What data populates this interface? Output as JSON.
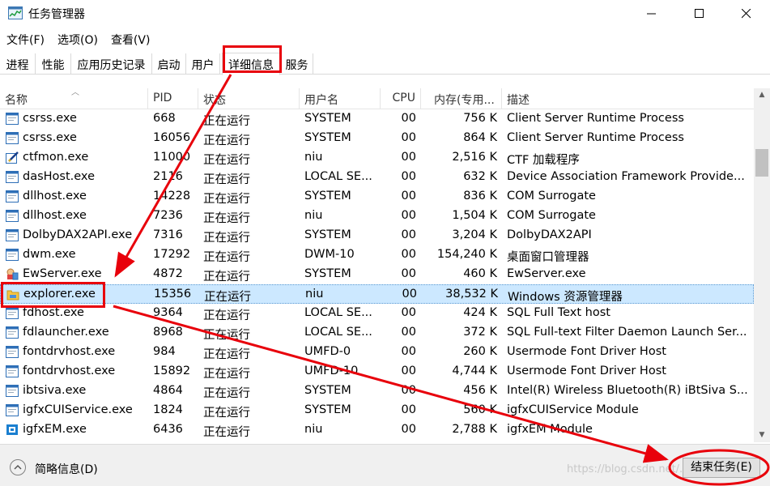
{
  "window": {
    "title": "任务管理器"
  },
  "menu": [
    "文件(F)",
    "选项(O)",
    "查看(V)"
  ],
  "tabs": [
    "进程",
    "性能",
    "应用历史记录",
    "启动",
    "用户",
    "详细信息",
    "服务"
  ],
  "active_tab": "详细信息",
  "columns": {
    "name": "名称",
    "pid": "PID",
    "status": "状态",
    "user": "用户名",
    "cpu": "CPU",
    "mem": "内存(专用...",
    "desc": "描述"
  },
  "processes": [
    {
      "name": "csrss.exe",
      "pid": "668",
      "status": "正在运行",
      "user": "SYSTEM",
      "cpu": "00",
      "mem": "756 K",
      "desc": "Client Server Runtime Process",
      "icon": "app-icon"
    },
    {
      "name": "csrss.exe",
      "pid": "16056",
      "status": "正在运行",
      "user": "SYSTEM",
      "cpu": "00",
      "mem": "864 K",
      "desc": "Client Server Runtime Process",
      "icon": "app-icon"
    },
    {
      "name": "ctfmon.exe",
      "pid": "11000",
      "status": "正在运行",
      "user": "niu",
      "cpu": "00",
      "mem": "2,516 K",
      "desc": "CTF 加载程序",
      "icon": "pen-icon"
    },
    {
      "name": "dasHost.exe",
      "pid": "2116",
      "status": "正在运行",
      "user": "LOCAL SE...",
      "cpu": "00",
      "mem": "632 K",
      "desc": "Device Association Framework Provide...",
      "icon": "app-icon"
    },
    {
      "name": "dllhost.exe",
      "pid": "14228",
      "status": "正在运行",
      "user": "SYSTEM",
      "cpu": "00",
      "mem": "836 K",
      "desc": "COM Surrogate",
      "icon": "app-icon"
    },
    {
      "name": "dllhost.exe",
      "pid": "7236",
      "status": "正在运行",
      "user": "niu",
      "cpu": "00",
      "mem": "1,504 K",
      "desc": "COM Surrogate",
      "icon": "app-icon"
    },
    {
      "name": "DolbyDAX2API.exe",
      "pid": "7316",
      "status": "正在运行",
      "user": "SYSTEM",
      "cpu": "00",
      "mem": "3,204 K",
      "desc": "DolbyDAX2API",
      "icon": "app-icon"
    },
    {
      "name": "dwm.exe",
      "pid": "17292",
      "status": "正在运行",
      "user": "DWM-10",
      "cpu": "00",
      "mem": "154,240 K",
      "desc": "桌面窗口管理器",
      "icon": "app-icon"
    },
    {
      "name": "EwServer.exe",
      "pid": "4872",
      "status": "正在运行",
      "user": "SYSTEM",
      "cpu": "00",
      "mem": "460 K",
      "desc": "EwServer.exe",
      "icon": "server-icon"
    },
    {
      "name": "explorer.exe",
      "pid": "15356",
      "status": "正在运行",
      "user": "niu",
      "cpu": "00",
      "mem": "38,532 K",
      "desc": "Windows 资源管理器",
      "icon": "folder-icon",
      "selected": true
    },
    {
      "name": "fdhost.exe",
      "pid": "9364",
      "status": "正在运行",
      "user": "LOCAL SE...",
      "cpu": "00",
      "mem": "424 K",
      "desc": "SQL Full Text host",
      "icon": "app-icon"
    },
    {
      "name": "fdlauncher.exe",
      "pid": "8968",
      "status": "正在运行",
      "user": "LOCAL SE...",
      "cpu": "00",
      "mem": "372 K",
      "desc": "SQL Full-text Filter Daemon Launch Ser...",
      "icon": "app-icon"
    },
    {
      "name": "fontdrvhost.exe",
      "pid": "984",
      "status": "正在运行",
      "user": "UMFD-0",
      "cpu": "00",
      "mem": "260 K",
      "desc": "Usermode Font Driver Host",
      "icon": "app-icon"
    },
    {
      "name": "fontdrvhost.exe",
      "pid": "15892",
      "status": "正在运行",
      "user": "UMFD-10",
      "cpu": "00",
      "mem": "4,744 K",
      "desc": "Usermode Font Driver Host",
      "icon": "app-icon"
    },
    {
      "name": "ibtsiva.exe",
      "pid": "4864",
      "status": "正在运行",
      "user": "SYSTEM",
      "cpu": "00",
      "mem": "456 K",
      "desc": "Intel(R) Wireless Bluetooth(R) iBtSiva S...",
      "icon": "app-icon"
    },
    {
      "name": "igfxCUIService.exe",
      "pid": "1824",
      "status": "正在运行",
      "user": "SYSTEM",
      "cpu": "00",
      "mem": "560 K",
      "desc": "igfxCUIService Module",
      "icon": "app-icon"
    },
    {
      "name": "igfxEM.exe",
      "pid": "6436",
      "status": "正在运行",
      "user": "niu",
      "cpu": "00",
      "mem": "2,788 K",
      "desc": "igfxEM Module",
      "icon": "chip-icon"
    }
  ],
  "footer": {
    "fewer_details": "简略信息(D)",
    "end_task": "结束任务(E)",
    "watermark": "https://blog.csdn.net/..."
  },
  "colors": {
    "selection": "#cce8ff",
    "annotation_red": "#e8000b"
  }
}
